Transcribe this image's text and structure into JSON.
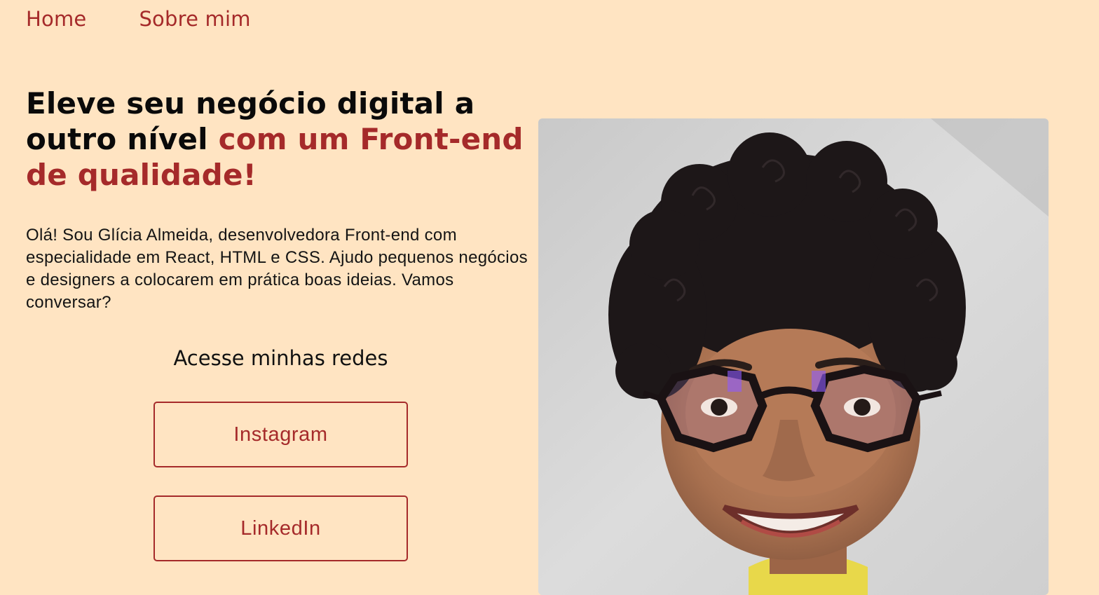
{
  "nav": {
    "home": "Home",
    "about": "Sobre mim"
  },
  "hero": {
    "headline_plain": "Eleve seu negócio digital a outro nível ",
    "headline_accent": "com um Front-end de qualidade!",
    "intro": "Olá! Sou Glícia Almeida, desenvolvedora Front-end com especialidade em React, HTML e CSS. Ajudo pequenos negócios e designers a colocarem em prática boas ideias. Vamos conversar?"
  },
  "social": {
    "title": "Acesse minhas redes",
    "instagram": "Instagram",
    "linkedin": "LinkedIn"
  },
  "colors": {
    "background": "#ffe4c2",
    "accent": "#a52a2a",
    "text": "#0a0a0a"
  },
  "photo": {
    "icon": "profile-photo"
  }
}
